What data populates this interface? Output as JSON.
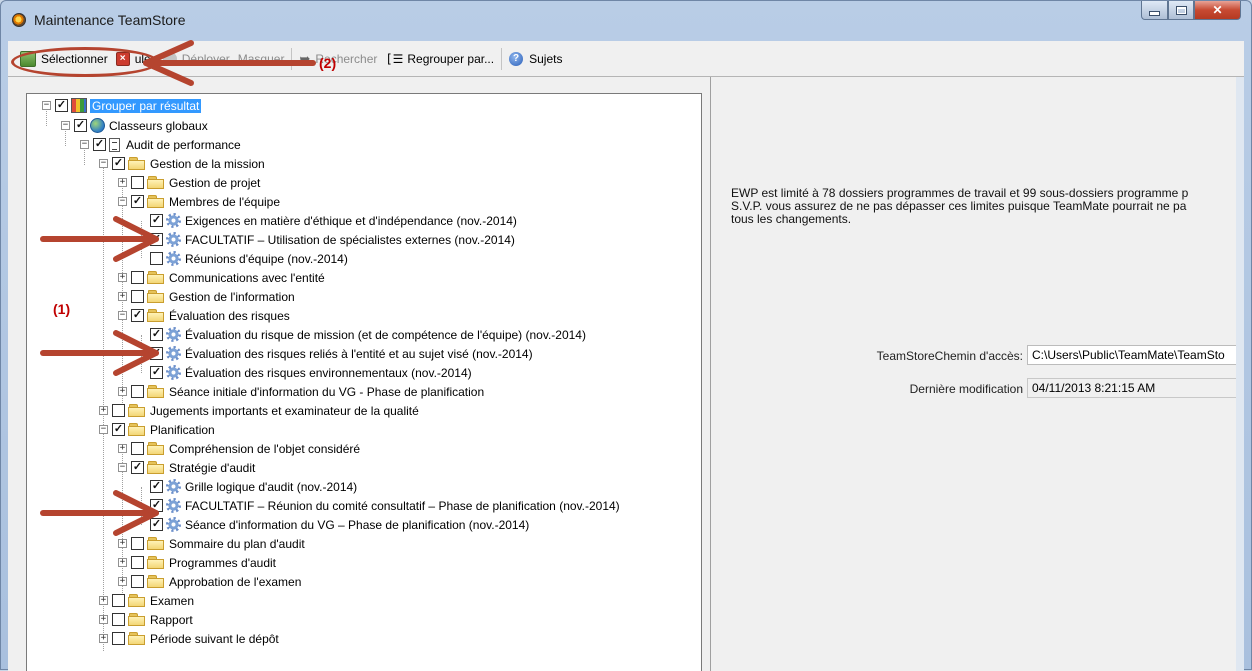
{
  "window": {
    "title": "Maintenance TeamStore"
  },
  "toolbar": {
    "select_label": "Sélectionner",
    "cancel_label": "uler",
    "unfold_label": "Déployer",
    "hide_label": "Masquer",
    "search_label": "Rechercher",
    "group_label": "Regrouper par...",
    "topics_label": "Sujets"
  },
  "annotations": {
    "label1": "(1)",
    "label2": "(2)"
  },
  "tree": {
    "root": "Grouper par résultat",
    "global": "Classeurs globaux",
    "audit": "Audit de performance",
    "mission": "Gestion de la mission",
    "project": "Gestion de projet",
    "team": "Membres de l'équipe",
    "ethics": "Exigences en matière d'éthique et d'indépendance  (nov.-2014)",
    "optional_specialists": "FACULTATIF – Utilisation de spécialistes externes (nov.-2014)",
    "team_meetings": "Réunions d'équipe (nov.-2014)",
    "communications": "Communications avec l'entité",
    "info_mgmt": "Gestion de l'information",
    "risk_eval": "Évaluation des risques",
    "risk_mission": "Évaluation du risque de mission (et de compétence de l'équipe) (nov.-2014)",
    "risk_entity": "Évaluation des risques reliés à l'entité et au sujet visé  (nov.-2014)",
    "risk_env": "Évaluation des risques environnementaux  (nov.-2014)",
    "initial_session": "Séance initiale d'information du VG - Phase de planification",
    "judgments": "Jugements importants et examinateur de la qualité",
    "planning": "Planification",
    "understanding": "Compréhension de l'objet considéré",
    "strategy": "Stratégie d'audit",
    "logic_grid": "Grille logique d'audit (nov.-2014)",
    "optional_committee": "FACULTATIF – Réunion du comité consultatif – Phase de planification (nov.-2014)",
    "vg_session": "Séance d'information du VG – Phase de planification (nov.-2014)",
    "plan_summary": "Sommaire du plan d'audit",
    "programs": "Programmes d'audit",
    "approval": "Approbation de l'examen",
    "exam": "Examen",
    "report": "Rapport",
    "post_filing": "Période suivant le dépôt"
  },
  "details": {
    "info_line1": "EWP est limité à 78 dossiers programmes de travail et 99 sous-dossiers programme p",
    "info_line2": "S.V.P. vous assurez de ne pas dépasser ces limites puisque TeamMate pourrait ne pa",
    "info_line3": "tous les changements.",
    "path_label": "TeamStoreChemin d'accès:",
    "path_value": "C:\\Users\\Public\\TeamMate\\TeamSto",
    "modified_label": "Dernière modification",
    "modified_value": "04/11/2013 8:21:15 AM"
  }
}
